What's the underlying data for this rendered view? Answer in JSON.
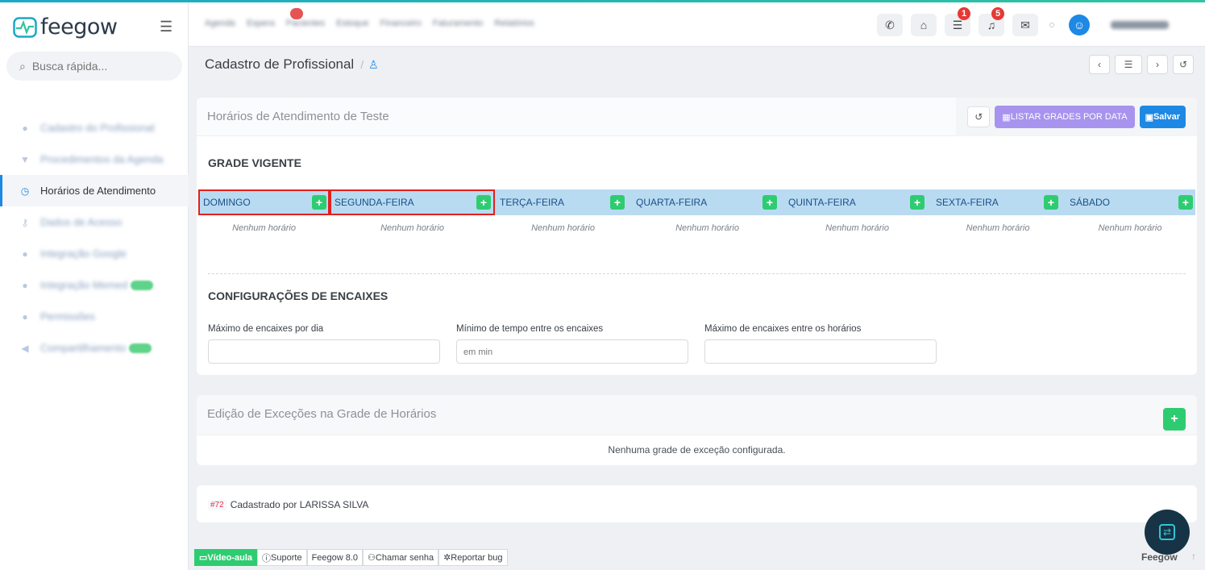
{
  "app": {
    "logo_text": "feegow"
  },
  "search": {
    "placeholder": "Busca rápida..."
  },
  "sidebar": {
    "items": [
      {
        "label": "Cadastro do Profissional",
        "blurred": true
      },
      {
        "label": "Procedimentos da Agenda",
        "blurred": true
      },
      {
        "label": "Horários de Atendimento",
        "blurred": false,
        "active": true
      },
      {
        "label": "Dados de Acesso",
        "blurred": true
      },
      {
        "label": "Integração Google",
        "blurred": true
      },
      {
        "label": "Integração Memed",
        "blurred": true
      },
      {
        "label": "Permissões",
        "blurred": true
      },
      {
        "label": "Compartilhamento",
        "blurred": true
      }
    ]
  },
  "topnav": {
    "items": [
      "Agenda",
      "Espera",
      "Pacientes",
      "Estoque",
      "Financeiro",
      "Faturamento",
      "Relatórios"
    ]
  },
  "topbar": {
    "badge_tasks": "1",
    "badge_notifications": "5",
    "user_name": "ANDRÉ MAIA"
  },
  "page": {
    "title": "Cadastro de Profissional",
    "separator": "/"
  },
  "schedule": {
    "title": "Horários de Atendimento de Teste",
    "list_button": "LISTAR GRADES POR DATA",
    "save_button": "Salvar",
    "section_title": "GRADE VIGENTE",
    "add_symbol": "+",
    "days": [
      {
        "name": "DOMINGO",
        "empty": "Nenhum horário"
      },
      {
        "name": "SEGUNDA-FEIRA",
        "empty": "Nenhum horário"
      },
      {
        "name": "TERÇA-FEIRA",
        "empty": "Nenhum horário"
      },
      {
        "name": "QUARTA-FEIRA",
        "empty": "Nenhum horário"
      },
      {
        "name": "QUINTA-FEIRA",
        "empty": "Nenhum horário"
      },
      {
        "name": "SEXTA-FEIRA",
        "empty": "Nenhum horário"
      },
      {
        "name": "SÁBADO",
        "empty": "Nenhum horário"
      }
    ]
  },
  "encaixes": {
    "title": "CONFIGURAÇÕES DE ENCAIXES",
    "fields": [
      {
        "label": "Máximo de encaixes por dia",
        "placeholder": ""
      },
      {
        "label": "Mínimo de tempo entre os encaixes",
        "placeholder": "em min"
      },
      {
        "label": "Máximo de encaixes entre os horários",
        "placeholder": ""
      }
    ]
  },
  "exceptions": {
    "title": "Edição de Exceções na Grade de Horários",
    "empty": "Nenhuma grade de exceção configurada."
  },
  "registry": {
    "id": "#72",
    "text": "Cadastrado por LARISSA SILVA"
  },
  "footer": {
    "video": "Vídeo-aula",
    "support": "Suporte",
    "version": "Feegow 8.0",
    "call": "Chamar senha",
    "bug": "Reportar bug",
    "brand": "Feegow"
  }
}
